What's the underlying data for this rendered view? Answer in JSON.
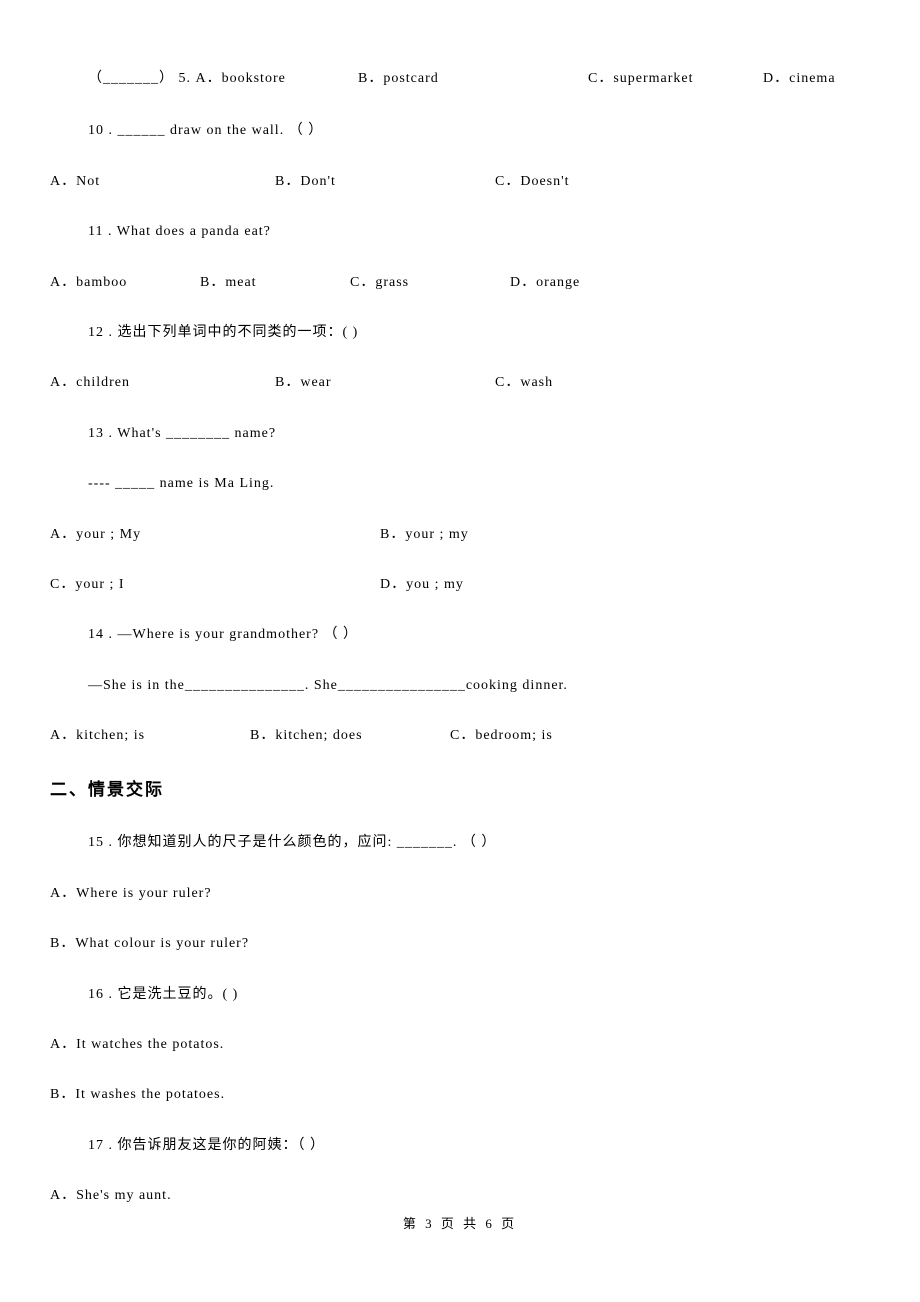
{
  "q9": {
    "prefix": "（_______） 5. A．bookstore",
    "optB": "B．postcard",
    "optC": "C．supermarket",
    "optD": "D．cinema"
  },
  "q10": {
    "stem": "10 . ______ draw on the wall. （   ）",
    "optA": "A．Not",
    "optB": "B．Don't",
    "optC": "C．Doesn't"
  },
  "q11": {
    "stem": "11 . What does a panda eat?",
    "optA": "A．bamboo",
    "optB": "B．meat",
    "optC": "C．grass",
    "optD": "D．orange"
  },
  "q12": {
    "stem": "12 . 选出下列单词中的不同类的一项：(    )",
    "optA": "A．children",
    "optB": "B．wear",
    "optC": "C．wash"
  },
  "q13": {
    "stem1": "13 . What's ________ name?",
    "stem2": "---- _____ name is Ma Ling.",
    "optA": "A．your ; My",
    "optB": "B．your ; my",
    "optC": "C．your ; I",
    "optD": "D．you ; my"
  },
  "q14": {
    "stem1": "14 . —Where is your grandmother? （   ）",
    "stem2": "—She is in the_______________. She________________cooking dinner.",
    "optA": "A．kitchen; is",
    "optB": "B．kitchen; does",
    "optC": "C．bedroom; is"
  },
  "section2": "二、情景交际",
  "q15": {
    "stem": "15 . 你想知道别人的尺子是什么颜色的，应问:  _______. （   ）",
    "optA": "A．Where  is  your  ruler?",
    "optB": "B．What  colour  is  your  ruler?"
  },
  "q16": {
    "stem": "16 . 它是洗土豆的。(    )",
    "optA": "A．It watches the potatos.",
    "optB": "B．It washes the potatoes."
  },
  "q17": {
    "stem": "17 . 你告诉朋友这是你的阿姨：（   ）",
    "optA": "A．She's my aunt."
  },
  "footer": "第 3 页 共 6 页"
}
